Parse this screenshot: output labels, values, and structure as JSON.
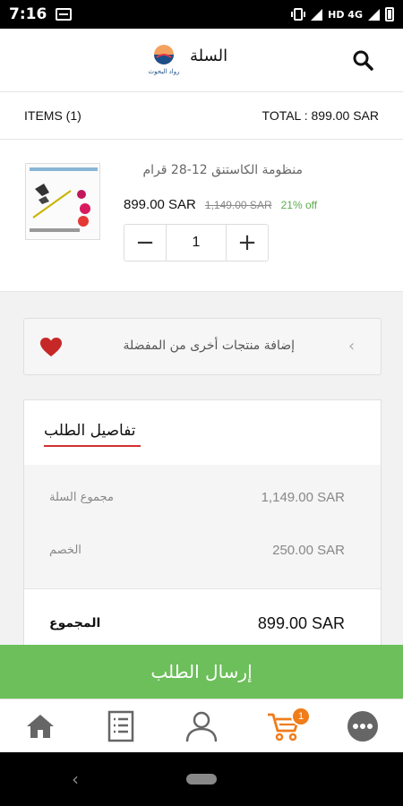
{
  "status_bar": {
    "time": "7:16",
    "network": "HD 4G",
    "icons": [
      "notification-icon",
      "vibrate-icon",
      "wifi-icon",
      "signal-icon",
      "battery-icon"
    ]
  },
  "header": {
    "title": "السلة",
    "logo_text": "رواد البحوث",
    "icons": [
      "search-icon",
      "logo-icon"
    ]
  },
  "summary": {
    "items_label": "ITEMS (1)",
    "total_label": "TOTAL : 899.00 SAR"
  },
  "product": {
    "name": "منظومة الكاستنق 12-28 قرام",
    "price": "899.00 SAR",
    "old_price": "1,149.00 SAR",
    "discount": "21% off",
    "quantity": "1",
    "decrement_symbol": "−",
    "increment_symbol": "+"
  },
  "wishlist": {
    "label": "إضافة منتجات أخرى من المفضلة",
    "chevron": "‹",
    "icons": [
      "heart-icon",
      "chevron-left-icon"
    ]
  },
  "order_details": {
    "title": "تفاصيل الطلب",
    "rows": [
      {
        "label": "مجموع السلة",
        "value": "1,149.00 SAR"
      },
      {
        "label": "الخصم",
        "value": "250.00 SAR"
      }
    ],
    "total_label": "المجموع",
    "total_value": "899.00 SAR"
  },
  "submit": {
    "label": "إرسال الطلب"
  },
  "bottom_nav": {
    "items": [
      {
        "name": "home",
        "icon": "home-icon"
      },
      {
        "name": "orders",
        "icon": "list-icon"
      },
      {
        "name": "account",
        "icon": "user-icon"
      },
      {
        "name": "cart",
        "icon": "cart-icon",
        "badge": "1"
      },
      {
        "name": "more",
        "icon": "more-icon"
      }
    ]
  },
  "colors": {
    "primary_green": "#6cbf5a",
    "discount_green": "#5aac49",
    "cart_orange": "#f07c1a",
    "accent_red": "#d32f2f",
    "heart_red": "#c62828"
  }
}
